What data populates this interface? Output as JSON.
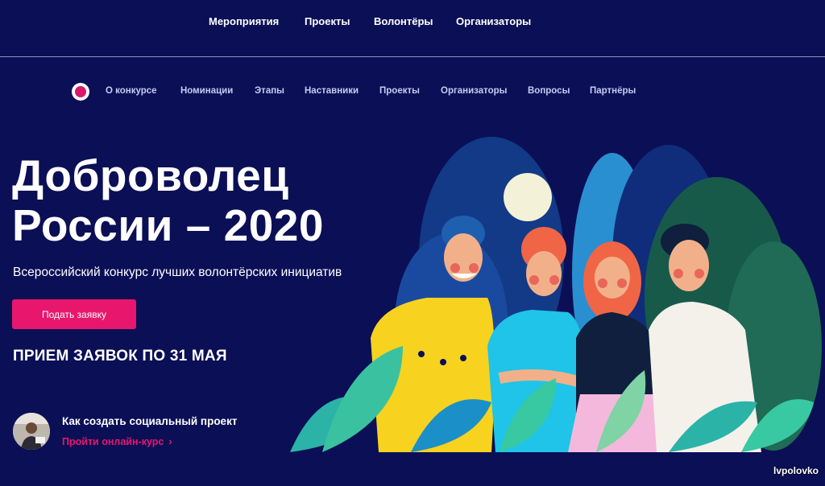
{
  "top_nav": {
    "items": [
      "Мероприятия",
      "Проекты",
      "Волонтёры",
      "Организаторы"
    ]
  },
  "sub_nav": {
    "items": [
      "О конкурсе",
      "Номинации",
      "Этапы",
      "Наставники",
      "Проекты",
      "Организаторы",
      "Вопросы",
      "Партнёры"
    ]
  },
  "hero": {
    "title_line1": "Доброволец",
    "title_line2": "России – 2020",
    "subtitle": "Всероссийский конкурс лучших волонтёрских инициатив",
    "apply_label": "Подать заявку",
    "deadline": "ПРИЕМ ЗАЯВОК ПО 31 МАЯ"
  },
  "course": {
    "title": "Как создать социальный проект",
    "link_label": "Пройти онлайн-курс",
    "link_chevron": "›"
  },
  "watermark": "lvpolovko",
  "colors": {
    "background": "#0b0f56",
    "accent": "#e8176d",
    "subnav_text": "#c7cbf2"
  }
}
